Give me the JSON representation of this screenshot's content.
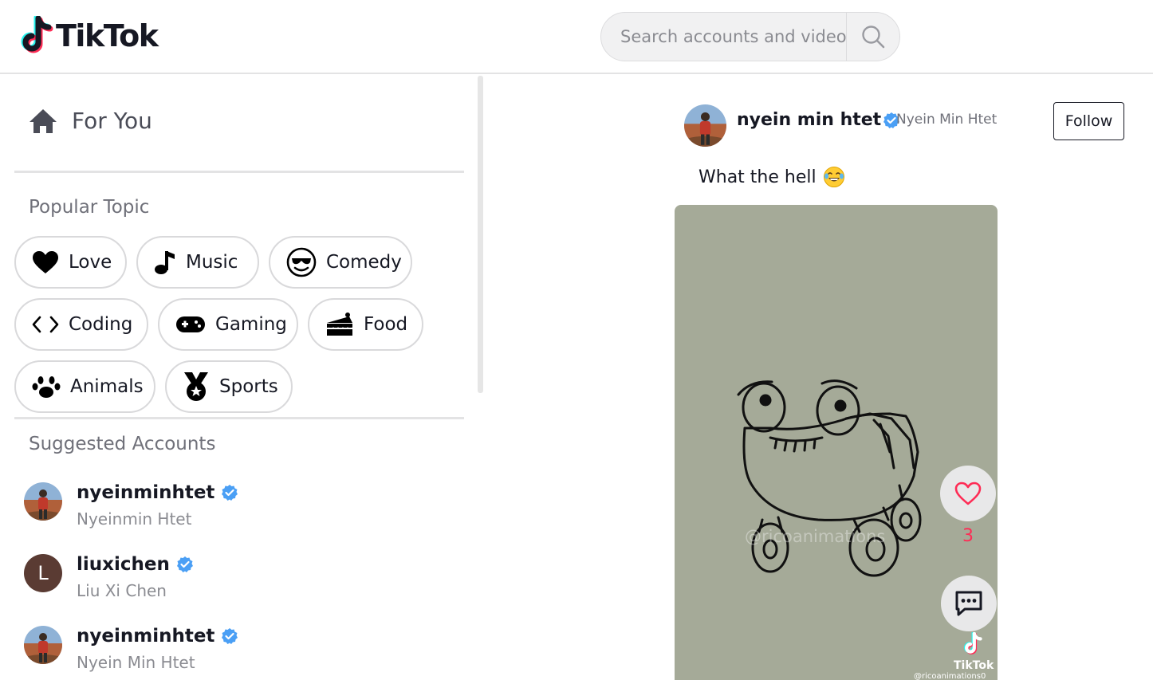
{
  "header": {
    "logo_text": "TikTok",
    "search_placeholder": "Search accounts and videos"
  },
  "sidebar": {
    "for_you_label": "For You",
    "popular_topic_title": "Popular Topic",
    "topics": [
      {
        "label": "Love",
        "icon": "heart-icon"
      },
      {
        "label": "Music",
        "icon": "music-note-icon"
      },
      {
        "label": "Comedy",
        "icon": "sunglasses-smiley-icon"
      },
      {
        "label": "Coding",
        "icon": "code-brackets-icon"
      },
      {
        "label": "Gaming",
        "icon": "gamepad-icon"
      },
      {
        "label": "Food",
        "icon": "cake-slice-icon"
      },
      {
        "label": "Animals",
        "icon": "paw-icon"
      },
      {
        "label": "Sports",
        "icon": "medal-icon"
      }
    ],
    "suggested_title": "Suggested Accounts",
    "accounts": [
      {
        "handle": "nyeinminhtet",
        "name": "Nyeinmin Htet",
        "verified": true
      },
      {
        "handle": "liuxichen",
        "name": "Liu Xi Chen",
        "verified": true,
        "avatar_letter": "L"
      },
      {
        "handle": "nyeinminhtet",
        "name": "Nyein Min Htet",
        "verified": true
      }
    ]
  },
  "post": {
    "handle": "nyein min htet",
    "name": "Nyein Min Htet",
    "follow_label": "Follow",
    "caption": "What the hell",
    "caption_emoji": "laughing-tears-emoji",
    "like_count": "3",
    "video_watermark": "@ricoanimations",
    "video_brand": "TikTok",
    "video_credit": "@ricoanimations0"
  },
  "colors": {
    "accent_red": "#fe2c55",
    "verified_blue": "#20d5ec",
    "video_bg": "#a5aa98"
  }
}
